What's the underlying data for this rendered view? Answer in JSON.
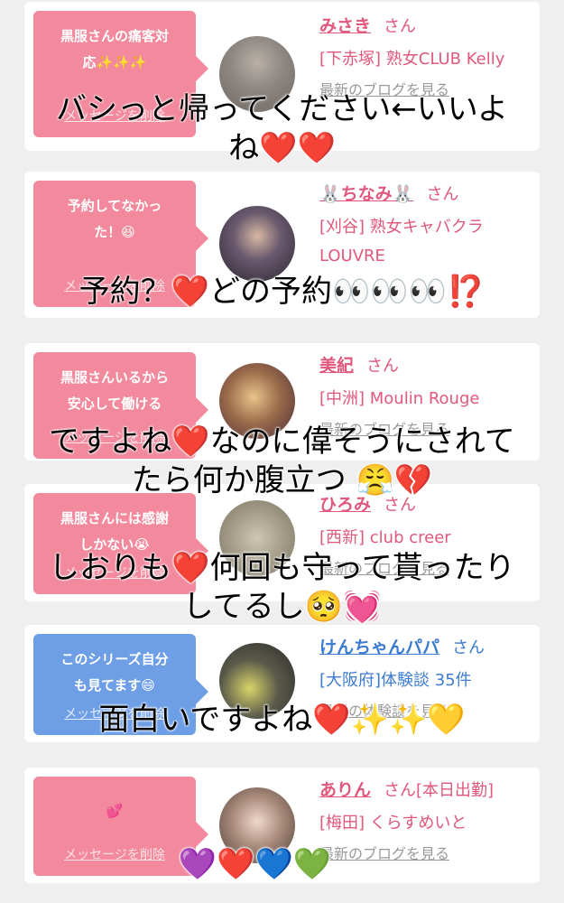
{
  "cards": [
    {
      "message": "黒服さんの痛客対\n応✨✨✨",
      "delete_label": "メッセージを削除",
      "name": "みさき",
      "honorific": "さん",
      "shop": "[下赤塚] 熟女CLUB Kelly",
      "blog_label": "最新のブログを見る",
      "color": "#f2899d"
    },
    {
      "message": "予約してなかっ\nた！😆",
      "delete_label": "メッセージを削除",
      "name": "🐰ちなみ🐰",
      "honorific": "さん",
      "shop": "[刈谷] 熟女キャバクラ LOUVRE",
      "blog_label": "",
      "color": "#f2899d"
    },
    {
      "message": "黒服さんいるから\n安心して働ける",
      "delete_label": "メッセージを削除",
      "name": "美紀",
      "honorific": "さん",
      "shop": "[中洲] Moulin Rouge",
      "blog_label": "最新のブログを見る",
      "color": "#f2899d"
    },
    {
      "message": "黒服さんには感謝\nしかない😭",
      "delete_label": "メッセージを削除",
      "name": "ひろみ",
      "honorific": "さん",
      "shop": "[西新] club creer",
      "blog_label": "最新のブログを見る",
      "color": "#f2899d"
    },
    {
      "message": "このシリーズ自分\nも見てます😄",
      "delete_label": "メッセージを削除",
      "name": "けんちゃんパパ",
      "honorific": "さん",
      "shop": "[大阪府]体験談 35件",
      "blog_label": "最新の体験談を見る",
      "color": "#6d9ee6"
    },
    {
      "message": "💕",
      "delete_label": "メッセージを削除",
      "name": "ありん",
      "honorific": "さん[本日出勤]",
      "shop": "[梅田] くらすめいと",
      "blog_label": "最新のブログを見る",
      "color": "#f2899d"
    }
  ],
  "overlays": [
    "バシっと帰ってください←いいよ\nね❤️❤️",
    "予約？❤️どの予約👀👀👀⁉️",
    "ですよね❤️なのに偉そうにされて\nたら何か腹立つ 😤💔",
    "しおりも❤️何回も守って貰ったり\nしてるし🥺💓",
    "面白いですよね❤️✨✨💛",
    "💜❤️💙💚"
  ]
}
